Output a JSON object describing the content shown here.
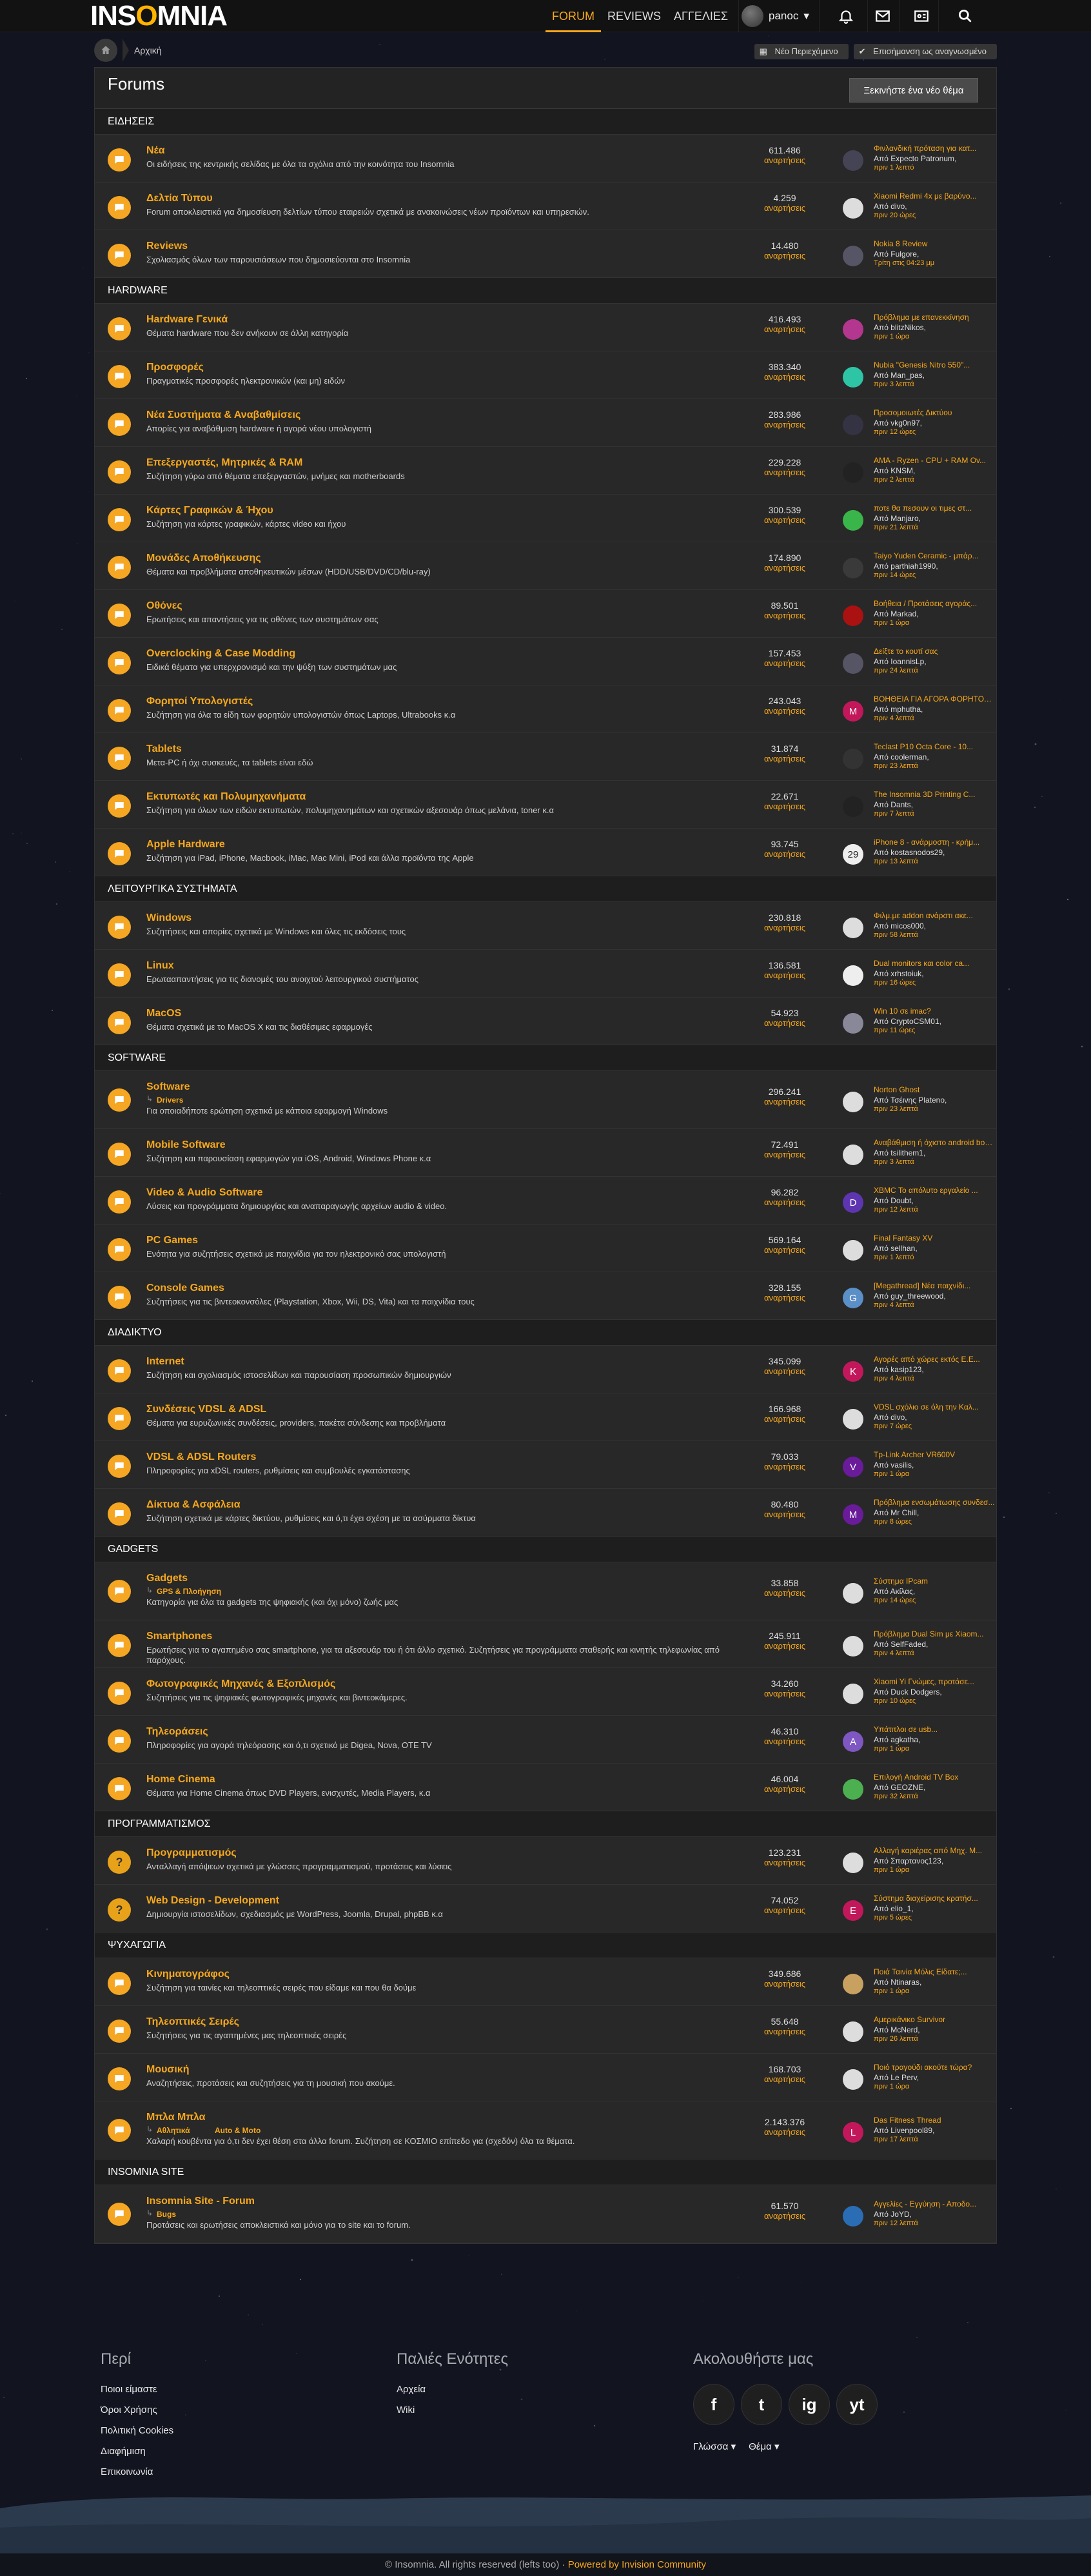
{
  "header": {
    "logo": "INSOMNIA",
    "nav": [
      "FORUM",
      "REVIEWS",
      "ΑΓΓΕΛΙΕΣ"
    ],
    "active_nav": 0,
    "username": "panoc",
    "icons": [
      "bell-icon",
      "mail-icon",
      "id-card-icon",
      "search-icon"
    ]
  },
  "breadcrumb": {
    "home": "Αρχική",
    "new_content": "Νέο Περιεχόμενο",
    "mark_read": "Επισήμανση ως αναγνωσμένο"
  },
  "page": {
    "title": "Forums",
    "start_topic": "Ξεκινήστε ένα νέο θέμα"
  },
  "categories": [
    {
      "name": "ΕΙΔΗΣΕΙΣ",
      "forums": [
        {
          "title": "Νέα",
          "desc": "Οι ειδήσεις της κεντρικής σελίδας με όλα τα σχόλια από την κοινότητα του Insomnia",
          "count": "611.486",
          "unit": "αναρτήσεις",
          "last_title": "Φινλανδική πρόταση για κατ...",
          "last_by": "Από Expecto Patronum,",
          "last_date": "πριν 1 λεπτό",
          "avatar_color": "#445",
          "avatar_letter": ""
        },
        {
          "title": "Δελτία Τύπου",
          "desc": "Forum αποκλειστικά για δημοσίευση δελτίων τύπου εταιρειών σχετικά με ανακοινώσεις νέων προϊόντων και υπηρεσιών.",
          "count": "4.259",
          "unit": "αναρτήσεις",
          "last_title": "Xiaomi Redmi 4x με βαρύνο...",
          "last_by": "Από divo,",
          "last_date": "πριν 20 ώρες",
          "avatar_color": "#ddd",
          "avatar_letter": ""
        },
        {
          "title": "Reviews",
          "desc": "Σχολιασμός όλων των παρουσιάσεων που δημοσιεύονται στο Insomnia",
          "count": "14.480",
          "unit": "αναρτήσεις",
          "last_title": "Nokia 8 Review",
          "last_by": "Από Fulgore,",
          "last_date": "Τρίτη στις 04:23 μμ",
          "avatar_color": "#556",
          "avatar_letter": ""
        }
      ]
    },
    {
      "name": "HARDWARE",
      "forums": [
        {
          "title": "Hardware Γενικά",
          "desc": "Θέματα hardware που δεν ανήκουν σε άλλη κατηγορία",
          "count": "416.493",
          "unit": "αναρτήσεις",
          "last_title": "Πρόβλημα με επανεκκίνηση",
          "last_by": "Από blitzNikos,",
          "last_date": "πριν 1 ώρα",
          "avatar_color": "#b3368f",
          "avatar_letter": ""
        },
        {
          "title": "Προσφορές",
          "desc": "Πραγματικές προσφορές ηλεκτρονικών (και μη) ειδών",
          "count": "383.340",
          "unit": "αναρτήσεις",
          "last_title": "Nubia \"Genesis Nitro 550\"...",
          "last_by": "Από Man_pas,",
          "last_date": "πριν 3 λεπτά",
          "avatar_color": "#2ec4a6",
          "avatar_letter": ""
        },
        {
          "title": "Νέα Συστήματα & Αναβαθμίσεις",
          "desc": "Απορίες για αναβάθμιση hardware ή αγορά νέου υπολογιστή",
          "count": "283.986",
          "unit": "αναρτήσεις",
          "last_title": "Προσομοιωτές Δικτύου",
          "last_by": "Από vkg0n97,",
          "last_date": "πριν 12 ώρες",
          "avatar_color": "#334",
          "avatar_letter": ""
        },
        {
          "title": "Επεξεργαστές, Μητρικές & RAM",
          "desc": "Συζήτηση γύρω από θέματα επεξεργαστών, μνήμες και motherboards",
          "count": "229.228",
          "unit": "αναρτήσεις",
          "last_title": "AMA - Ryzen - CPU + RAM Ov...",
          "last_by": "Από KNSM,",
          "last_date": "πριν 2 λεπτά",
          "avatar_color": "#222",
          "avatar_letter": ""
        },
        {
          "title": "Κάρτες Γραφικών & Ήχου",
          "desc": "Συζήτηση για κάρτες γραφικών, κάρτες video και ήχου",
          "count": "300.539",
          "unit": "αναρτήσεις",
          "last_title": "ποτε θα πεσουν οι τιμες στ...",
          "last_by": "Από Manjaro,",
          "last_date": "πριν 21 λεπτά",
          "avatar_color": "#3ab54a",
          "avatar_letter": ""
        },
        {
          "title": "Μονάδες Αποθήκευσης",
          "desc": "Θέματα και προβλήματα αποθηκευτικών μέσων (HDD/USB/DVD/CD/blu-ray)",
          "count": "174.890",
          "unit": "αναρτήσεις",
          "last_title": "Taiyo Yuden Ceramic - μπάρ...",
          "last_by": "Από parthiah1990,",
          "last_date": "πριν 14 ώρες",
          "avatar_color": "#3a3a3a",
          "avatar_letter": ""
        },
        {
          "title": "Οθόνες",
          "desc": "Ερωτήσεις και απαντήσεις για τις οθόνες των συστημάτων σας",
          "count": "89.501",
          "unit": "αναρτήσεις",
          "last_title": "Βοήθεια / Προτάσεις αγοράς...",
          "last_by": "Από Markad,",
          "last_date": "πριν 1 ώρα",
          "avatar_color": "#a11",
          "avatar_letter": ""
        },
        {
          "title": "Overclocking & Case Modding",
          "desc": "Ειδικά θέματα για υπερχρονισμό και την ψύξη των συστημάτων μας",
          "count": "157.453",
          "unit": "αναρτήσεις",
          "last_title": "Δείξτε το κουτί σας",
          "last_by": "Από IoannisLp,",
          "last_date": "πριν 24 λεπτά",
          "avatar_color": "#556",
          "avatar_letter": ""
        },
        {
          "title": "Φορητοί Υπολογιστές",
          "desc": "Συζήτηση για όλα τα είδη των φορητών υπολογιστών όπως Laptops, Ultrabooks κ.α",
          "count": "243.043",
          "unit": "αναρτήσεις",
          "last_title": "ΒΟΗΘΕΙΑ ΓΙΑ ΑΓΟΡΑ ΦΟΡΗΤΟΥ ...",
          "last_by": "Από mphutha,",
          "last_date": "πριν 4 λεπτά",
          "avatar_color": "#c2185b",
          "avatar_letter": "M"
        },
        {
          "title": "Tablets",
          "desc": "Μετα-PC ή όχι συσκευές, τα tablets είναι εδώ",
          "count": "31.874",
          "unit": "αναρτήσεις",
          "last_title": "Teclast P10 Octa Core - 10...",
          "last_by": "Από coolerman,",
          "last_date": "πριν 23 λεπτά",
          "avatar_color": "#333",
          "avatar_letter": ""
        },
        {
          "title": "Εκτυπωτές και Πολυμηχανήματα",
          "desc": "Συζήτηση για όλων των ειδών εκτυπωτών, πολυμηχανημάτων και σχετικών αξεσουάρ όπως μελάνια, toner κ.α",
          "count": "22.671",
          "unit": "αναρτήσεις",
          "last_title": "The Insomnia 3D Printing C...",
          "last_by": "Από Dants,",
          "last_date": "πριν 7 λεπτά",
          "avatar_color": "#222",
          "avatar_letter": ""
        },
        {
          "title": "Apple Hardware",
          "desc": "Συζήτηση για iPad, iPhone, Macbook, iMac, Mac Mini, iPod και άλλα προϊόντα της Apple",
          "count": "93.745",
          "unit": "αναρτήσεις",
          "last_title": "iPhone 8 - ανάρμοστη - κρήμ...",
          "last_by": "Από kostasnodos29,",
          "last_date": "πριν 13 λεπτά",
          "avatar_color": "#eee",
          "avatar_letter": "29"
        }
      ]
    },
    {
      "name": "ΛΕΙΤΟΥΡΓΙΚΑ ΣΥΣΤΗΜΑΤΑ",
      "forums": [
        {
          "title": "Windows",
          "desc": "Συζητήσεις και απορίες σχετικά με Windows και όλες τις εκδόσεις τους",
          "count": "230.818",
          "unit": "αναρτήσεις",
          "last_title": "Φιλμ.με addon ανάρστι ακε...",
          "last_by": "Από micos000,",
          "last_date": "πριν 58 λεπτά",
          "avatar_color": "#ddd",
          "avatar_letter": ""
        },
        {
          "title": "Linux",
          "desc": "Ερωτααπαντήσεις για τις διανομές του ανοιχτού λειτουργικού συστήματος",
          "count": "136.581",
          "unit": "αναρτήσεις",
          "last_title": "Dual monitors και color ca...",
          "last_by": "Από xrhstoiuk,",
          "last_date": "πριν 16 ώρες",
          "avatar_color": "#eee",
          "avatar_letter": ""
        },
        {
          "title": "MacOS",
          "desc": "Θέματα σχετικά με το MacOS X και τις διαθέσιμες εφαρμογές",
          "count": "54.923",
          "unit": "αναρτήσεις",
          "last_title": "Win 10 σε imac?",
          "last_by": "Από CryptoCSM01,",
          "last_date": "πριν 11 ώρες",
          "avatar_color": "#889",
          "avatar_letter": ""
        }
      ]
    },
    {
      "name": "SOFTWARE",
      "forums": [
        {
          "title": "Software",
          "sub": [
            "Drivers"
          ],
          "desc": "Για οποιαδήποτε ερώτηση σχετικά με κάποια εφαρμογή Windows",
          "count": "296.241",
          "unit": "αναρτήσεις",
          "last_title": "Norton Ghost",
          "last_by": "Από Τσέινης Plateno,",
          "last_date": "πριν 23 λεπτά",
          "avatar_color": "#ddd",
          "avatar_letter": ""
        },
        {
          "title": "Mobile Software",
          "desc": "Συζήτηση και παρουσίαση εφαρμογών για iOS, Android, Windows Phone κ.α",
          "count": "72.491",
          "unit": "αναρτήσεις",
          "last_title": "Αναβάθμιση ή όχιστο android boot...",
          "last_by": "Από tsilithem1,",
          "last_date": "πριν 3 λεπτά",
          "avatar_color": "#ddd",
          "avatar_letter": ""
        },
        {
          "title": "Video & Audio Software",
          "desc": "Λύσεις και προγράμματα δημιουργίας και αναπαραγωγής αρχείων audio & video.",
          "count": "96.282",
          "unit": "αναρτήσεις",
          "last_title": "XBMC Το απόλυτο εργαλείο ...",
          "last_by": "Από Doubt,",
          "last_date": "πριν 12 λεπτά",
          "avatar_color": "#5e35b1",
          "avatar_letter": "D"
        },
        {
          "title": "PC Games",
          "desc": "Ενότητα για συζητήσεις σχετικά με παιχνίδια για τον ηλεκτρονικό σας υπολογιστή",
          "count": "569.164",
          "unit": "αναρτήσεις",
          "last_title": "Final Fantasy XV",
          "last_by": "Από sellhan,",
          "last_date": "πριν 1 λεπτό",
          "avatar_color": "#ddd",
          "avatar_letter": ""
        },
        {
          "title": "Console Games",
          "desc": "Συζητήσεις για τις βιντεοκονσόλες (Playstation, Xbox, Wii, DS, Vita) και τα παιχνίδια τους",
          "count": "328.155",
          "unit": "αναρτήσεις",
          "last_title": "[Megathread] Νέα παιχνίδι...",
          "last_by": "Από guy_threewood,",
          "last_date": "πριν 4 λεπτά",
          "avatar_color": "#5b8fc7",
          "avatar_letter": "G"
        }
      ]
    },
    {
      "name": "ΔΙΑΔΙΚΤΥΟ",
      "forums": [
        {
          "title": "Internet",
          "desc": "Συζήτηση και σχολιασμός ιστοσελίδων και παρουσίαση προσωπικών δημιουργιών",
          "count": "345.099",
          "unit": "αναρτήσεις",
          "last_title": "Αγορές από χώρες εκτός Ε.Ε...",
          "last_by": "Από kasip123,",
          "last_date": "πριν 4 λεπτά",
          "avatar_color": "#c2185b",
          "avatar_letter": "K"
        },
        {
          "title": "Συνδέσεις VDSL & ADSL",
          "desc": "Θέματα για ευρυζωνικές συνδέσεις, providers, πακέτα σύνδεσης και προβλήματα",
          "count": "166.968",
          "unit": "αναρτήσεις",
          "last_title": "VDSL σχόλιο σε όλη την Καλ...",
          "last_by": "Από divo,",
          "last_date": "πριν 7 ώρες",
          "avatar_color": "#ddd",
          "avatar_letter": ""
        },
        {
          "title": "VDSL & ADSL Routers",
          "desc": "Πληροφορίες για xDSL routers, ρυθμίσεις και συμβουλές εγκατάστασης",
          "count": "79.033",
          "unit": "αναρτήσεις",
          "last_title": "Tp-Link Archer VR600V",
          "last_by": "Από vasilis,",
          "last_date": "πριν 1 ώρα",
          "avatar_color": "#6a1b9a",
          "avatar_letter": "V"
        },
        {
          "title": "Δίκτυα & Ασφάλεια",
          "desc": "Συζήτηση σχετικά με κάρτες δικτύου, ρυθμίσεις και ό,τι έχει σχέση με τα ασύρματα δίκτυα",
          "count": "80.480",
          "unit": "αναρτήσεις",
          "last_title": "Πρόβλημα ενσωμάτωσης συνδεσ...",
          "last_by": "Από Mr Chill,",
          "last_date": "πριν 8 ώρες",
          "avatar_color": "#6a1b9a",
          "avatar_letter": "M"
        }
      ]
    },
    {
      "name": "GADGETS",
      "forums": [
        {
          "title": "Gadgets",
          "sub": [
            "GPS & Πλοήγηση"
          ],
          "desc": "Κατηγορία για όλα τα gadgets της ψηφιακής (και όχι μόνο) ζωής μας",
          "count": "33.858",
          "unit": "αναρτήσεις",
          "last_title": "Σύστημα IPcam",
          "last_by": "Από Ακίλας,",
          "last_date": "πριν 14 ώρες",
          "avatar_color": "#ddd",
          "avatar_letter": ""
        },
        {
          "title": "Smartphones",
          "desc": "Ερωτήσεις για το αγαπημένο σας smartphone, για τα αξεσουάρ του ή ότι άλλο σχετικό. Συζητήσεις για προγράμματα σταθερής και κινητής τηλεφωνίας από παρόχους.",
          "count": "245.911",
          "unit": "αναρτήσεις",
          "last_title": "Πρόβλημα Dual Sim με Xiaom...",
          "last_by": "Από SelfFaded,",
          "last_date": "πριν 4 λεπτά",
          "avatar_color": "#ddd",
          "avatar_letter": ""
        },
        {
          "title": "Φωτογραφικές Μηχανές & Εξοπλισμός",
          "desc": "Συζητήσεις για τις ψηφιακές φωτογραφικές μηχανές και βιντεοκάμερες.",
          "count": "34.260",
          "unit": "αναρτήσεις",
          "last_title": "Xiaomi Yi Γνώμες, προτάσε...",
          "last_by": "Από Duck Dodgers,",
          "last_date": "πριν 10 ώρες",
          "avatar_color": "#ddd",
          "avatar_letter": ""
        },
        {
          "title": "Τηλεοράσεις",
          "desc": "Πληροφορίες για αγορά τηλεόρασης και ό,τι σχετικό με Digea, Nova, OTE TV",
          "count": "46.310",
          "unit": "αναρτήσεις",
          "last_title": "Υπάτιτλοι σε usb...",
          "last_by": "Από agkatha,",
          "last_date": "πριν 1 ώρα",
          "avatar_color": "#7e57c2",
          "avatar_letter": "A"
        },
        {
          "title": "Home Cinema",
          "desc": "Θέματα για Home Cinema όπως DVD Players, ενισχυτές, Media Players, κ.α",
          "count": "46.004",
          "unit": "αναρτήσεις",
          "last_title": "Επιλογή Android TV Box",
          "last_by": "Από GEOZNE,",
          "last_date": "πριν 32 λεπτά",
          "avatar_color": "#4caf50",
          "avatar_letter": ""
        }
      ]
    },
    {
      "name": "ΠΡΟΓΡΑΜΜΑΤΙΣΜΟΣ",
      "forums": [
        {
          "title": "Προγραμματισμός",
          "q": true,
          "desc": "Ανταλλαγή απόψεων σχετικά με γλώσσες προγραμματισμού, προτάσεις και λύσεις",
          "count": "123.231",
          "unit": "αναρτήσεις",
          "last_title": "Αλλαγή καριέρας από Μηχ. Μ...",
          "last_by": "Από Σπαρτανος123,",
          "last_date": "πριν 1 ώρα",
          "avatar_color": "#ddd",
          "avatar_letter": ""
        },
        {
          "title": "Web Design - Development",
          "q": true,
          "desc": "Δημιουργία ιστοσελίδων, σχεδιασμός με WordPress, Joomla, Drupal, phpBB κ.α",
          "count": "74.052",
          "unit": "αναρτήσεις",
          "last_title": "Σύστημα διαχείρισης κρατήσ...",
          "last_by": "Από elio_1,",
          "last_date": "πριν 5 ώρες",
          "avatar_color": "#c2185b",
          "avatar_letter": "E"
        }
      ]
    },
    {
      "name": "ΨΥΧΑΓΩΓΙΑ",
      "forums": [
        {
          "title": "Κινηματογράφος",
          "desc": "Συζήτηση για ταινίες και τηλεοπτικές σειρές που είδαμε και που θα δούμε",
          "count": "349.686",
          "unit": "αναρτήσεις",
          "last_title": "Ποιά Ταινία Μόλις Είδατε;...",
          "last_by": "Από Ntinaras,",
          "last_date": "πριν 1 ώρα",
          "avatar_color": "#c8a060",
          "avatar_letter": ""
        },
        {
          "title": "Τηλεοπτικές Σειρές",
          "desc": "Συζητήσεις για τις αγαπημένες μας τηλεοπτικές σειρές",
          "count": "55.648",
          "unit": "αναρτήσεις",
          "last_title": "Αμερικάνικο Survivor",
          "last_by": "Από McNerd,",
          "last_date": "πριν 26 λεπτά",
          "avatar_color": "#ddd",
          "avatar_letter": ""
        },
        {
          "title": "Μουσική",
          "desc": "Αναζητήσεις, προτάσεις και συζητήσεις για τη μουσική που ακούμε.",
          "count": "168.703",
          "unit": "αναρτήσεις",
          "last_title": "Ποιό τραγούδι ακούτε τώρα?",
          "last_by": "Από Le Perv,",
          "last_date": "πριν 1 ώρα",
          "avatar_color": "#ddd",
          "avatar_letter": ""
        },
        {
          "title": "Μπλα Μπλα",
          "sub": [
            "Αθλητικά",
            "Auto & Moto"
          ],
          "desc": "Χαλαρή κουβέντα για ό,τι δεν έχει θέση στα άλλα forum. Συζήτηση σε ΚΟΣΜΙΟ επίπεδο για (σχεδόν) όλα τα θέματα.",
          "count": "2.143.376",
          "unit": "αναρτήσεις",
          "last_title": "Das Fitness Thread",
          "last_by": "Από Livenpool89,",
          "last_date": "πριν 17 λεπτά",
          "avatar_color": "#c2185b",
          "avatar_letter": "L"
        }
      ]
    },
    {
      "name": "INSOMNIA SITE",
      "forums": [
        {
          "title": "Insomnia Site - Forum",
          "sub": [
            "Bugs"
          ],
          "desc": "Προτάσεις και ερωτήσεις αποκλειστικά και μόνο για το site και το forum.",
          "count": "61.570",
          "unit": "αναρτήσεις",
          "last_title": "Αγγελίες - Εγγύηση - Αποδο...",
          "last_by": "Από JoYD,",
          "last_date": "πριν 12 λεπτά",
          "avatar_color": "#2a6db5",
          "avatar_letter": ""
        }
      ]
    }
  ],
  "footer": {
    "about_title": "Περί",
    "about_links": [
      "Ποιοι είμαστε",
      "Όροι Χρήσης",
      "Πολιτική Cookies",
      "Διαφήμιση",
      "Επικοινωνία"
    ],
    "old_title": "Παλιές Ενότητες",
    "old_links": [
      "Αρχεία",
      "Wiki"
    ],
    "follow_title": "Ακολουθήστε μας",
    "social": [
      "f",
      "t",
      "ig",
      "yt"
    ],
    "language": "Γλώσσα",
    "theme": "Θέμα",
    "copyright": "© Insomnia. All rights reserved (lefts too)",
    "powered": "Powered by Invision Community"
  }
}
